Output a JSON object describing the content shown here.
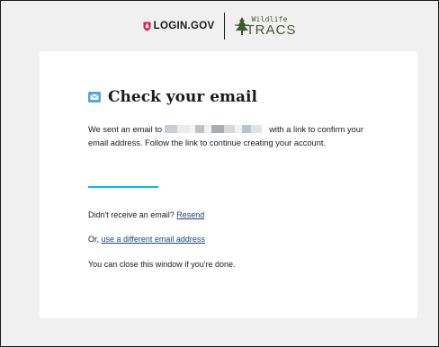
{
  "header": {
    "login_brand": "LOGIN.GOV",
    "partner_top": "Wildlife",
    "partner_bottom": "TRACS",
    "colors": {
      "login_red": "#e21c3d",
      "partner_green": "#3f5a2b"
    },
    "icons": {
      "login": "shield-icon",
      "partner": "tree-icon"
    }
  },
  "card": {
    "title": "Check your email",
    "title_icon": "email-icon",
    "message_before": "We sent an email to",
    "message_after": "with a link to confirm your email address. Follow the link to continue creating your account.",
    "redacted_email_shown": true,
    "resend_prefix": "Didn't receive an email?",
    "resend_link": "Resend",
    "different_prefix": "Or,",
    "different_link": "use a different email address",
    "close_note": "You can close this window if you're done.",
    "accent_color": "#00bde3"
  }
}
